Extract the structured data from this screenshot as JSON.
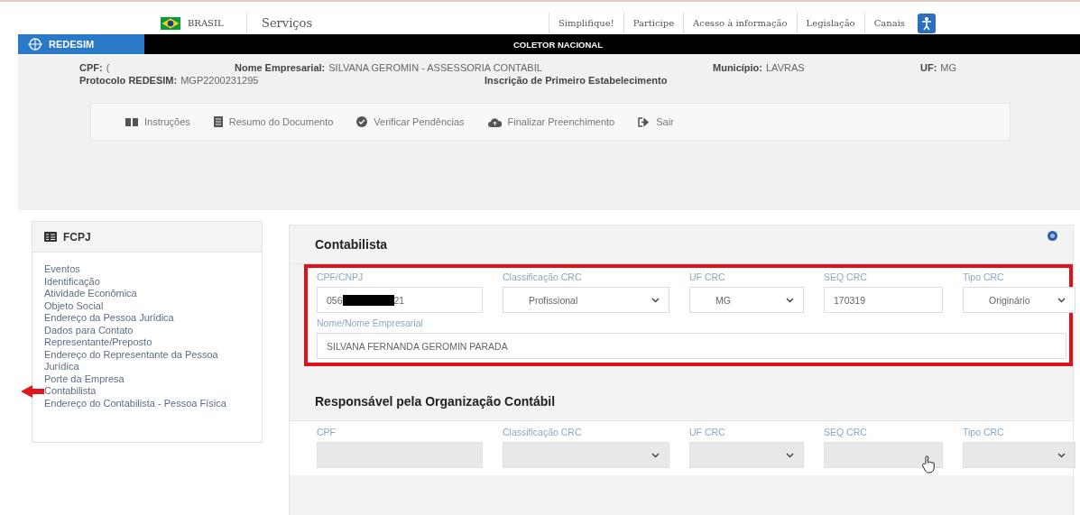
{
  "gov_bar": {
    "country": "BRASIL",
    "services": "Serviços",
    "links": [
      "Simplifique!",
      "Participe",
      "Acesso à informação",
      "Legislação",
      "Canais"
    ]
  },
  "header": {
    "logo": "REDESIM",
    "title": "COLETOR NACIONAL"
  },
  "info": {
    "row_1": [
      {
        "label": "CPF:",
        "value": "("
      },
      {
        "label": "Nome Empresarial:",
        "value": "SILVANA GEROMIN - ASSESSORIA CONTABIL"
      },
      {
        "label": "Município:",
        "value": "LAVRAS"
      },
      {
        "label": "UF:",
        "value": "MG"
      }
    ],
    "row_2": [
      {
        "label": "Protocolo REDESIM:",
        "value": "MGP2200231295"
      },
      {
        "label": "Inscrição de Primeiro Estabelecimento"
      }
    ]
  },
  "toolbar": [
    {
      "kind": "book",
      "label": "Instruções"
    },
    {
      "kind": "document",
      "label": "Resumo do Documento"
    },
    {
      "kind": "check",
      "label": "Verificar Pendências"
    },
    {
      "kind": "cloud",
      "label": "Finalizar Preenchimento"
    },
    {
      "kind": "exit",
      "label": "Sair"
    }
  ],
  "sidebar": {
    "title": "FCPJ",
    "items": [
      {
        "label": "Eventos",
        "selected": false
      },
      {
        "label": "Identificação",
        "selected": false
      },
      {
        "label": "Atividade Econômica",
        "selected": false
      },
      {
        "label": "Objeto Social",
        "selected": false
      },
      {
        "label": "Endereço da Pessoa Jurídica",
        "selected": false
      },
      {
        "label": "Dados para Contato",
        "selected": false
      },
      {
        "label": "Representante/Preposto",
        "selected": false
      },
      {
        "label": "Endereço do Representante da Pessoa Jurídica",
        "selected": false
      },
      {
        "label": "Porte da Empresa",
        "selected": false
      },
      {
        "label": "Contabilista",
        "selected": true
      },
      {
        "label": "Endereço do Contabilista - Pessoa Física",
        "selected": false
      }
    ]
  },
  "sections": [
    {
      "title": "Contabilista",
      "highlighted": true,
      "fields": [
        {
          "kind": "input",
          "label": "CPF/CNPJ",
          "value": "056",
          "value_end": "21",
          "redacted": true,
          "disabled": false
        },
        {
          "kind": "select",
          "label": "Classificação CRC",
          "value": "Profissional",
          "disabled": false
        },
        {
          "kind": "select",
          "label": "UF CRC",
          "value": "MG",
          "disabled": false
        },
        {
          "kind": "input",
          "label": "SEQ CRC",
          "value": "170319",
          "disabled": false
        },
        {
          "kind": "select",
          "label": "Tipo CRC",
          "value": "Originário",
          "disabled": false
        },
        {
          "kind": "input",
          "label": "Nome/Nome Empresarial",
          "value": "SILVANA FERNANDA GEROMIN PARADA",
          "disabled": false
        }
      ]
    },
    {
      "title": "Responsável pela Organização Contábil",
      "highlighted": false,
      "fields": [
        {
          "kind": "input",
          "label": "CPF",
          "disabled": true
        },
        {
          "kind": "select",
          "label": "Classificação CRC",
          "disabled": true
        },
        {
          "kind": "select",
          "label": "UF CRC",
          "disabled": true
        },
        {
          "kind": "input",
          "label": "SEQ CRC",
          "disabled": true
        },
        {
          "kind": "select",
          "label": "Tipo CRC",
          "disabled": true
        }
      ]
    }
  ]
}
